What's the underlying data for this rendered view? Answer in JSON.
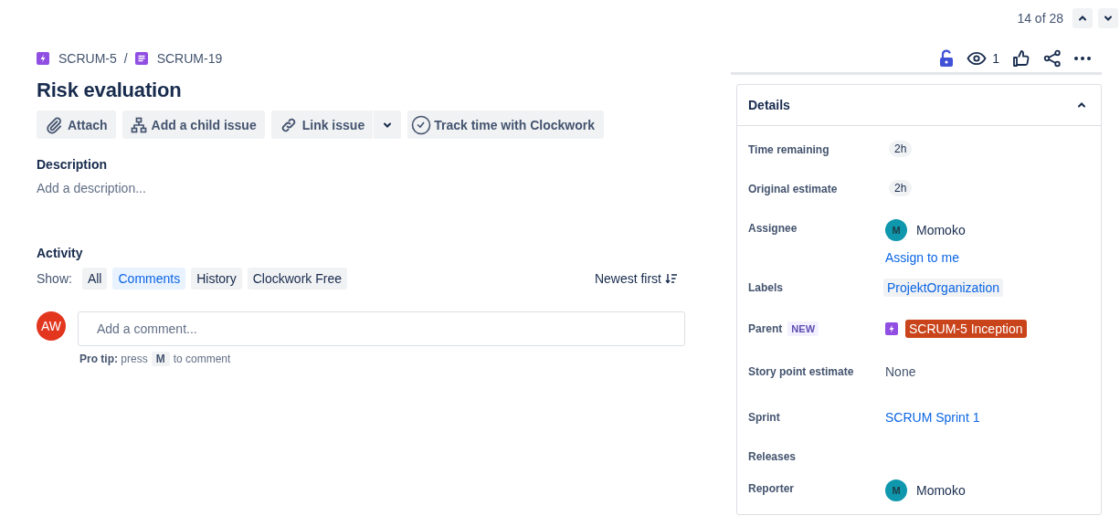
{
  "pager": {
    "text": "14 of 28"
  },
  "breadcrumbs": [
    {
      "kind": "epic",
      "label": "SCRUM-5"
    },
    {
      "kind": "story",
      "label": "SCRUM-19"
    }
  ],
  "breadcrumb_separator": "/",
  "title": "Risk evaluation",
  "actions": [
    {
      "kind": "attach",
      "label": "Attach",
      "menu": false
    },
    {
      "kind": "child",
      "label": "Add a child issue",
      "menu": false
    },
    {
      "kind": "link",
      "label": "Link issue",
      "menu": true
    },
    {
      "kind": "clock",
      "label": "Track time with Clockwork",
      "menu": false
    }
  ],
  "description": {
    "heading": "Description",
    "placeholder": "Add a description..."
  },
  "activity": {
    "heading": "Activity",
    "show_label": "Show:",
    "filters": [
      {
        "label": "All",
        "selected": false
      },
      {
        "label": "Comments",
        "selected": true
      },
      {
        "label": "History",
        "selected": false
      },
      {
        "label": "Clockwork Free",
        "selected": false
      }
    ],
    "sort": "Newest first",
    "avatar": "AW",
    "comment_placeholder": "Add a comment...",
    "tip": "**Pro tip:** press",
    "tip_key": "M",
    "tip_end": "to comment"
  },
  "toolbar": {
    "watchers": "1"
  },
  "details": {
    "title": "Details",
    "expanded": true,
    "fields": [
      {
        "kind": "chip",
        "label": "Time remaining",
        "value": "2h"
      },
      {
        "kind": "chip",
        "label": "Original estimate",
        "value": "2h"
      },
      {
        "kind": "user",
        "label": "Assignee",
        "initial": "M",
        "value": "Momoko",
        "action": "Assign to me"
      },
      {
        "kind": "tag",
        "label": "Labels",
        "value": "ProjektOrganization"
      },
      {
        "kind": "parent",
        "label": "Parent",
        "badge": "NEW",
        "value": "SCRUM-5 Inception"
      },
      {
        "kind": "text",
        "label": "Story point estimate",
        "value": "None"
      },
      {
        "kind": "link",
        "label": "Sprint",
        "value": "SCRUM Sprint 1"
      },
      {
        "kind": "empty",
        "label": "Releases"
      },
      {
        "kind": "user",
        "label": "Reporter",
        "initial": "M",
        "value": "Momoko"
      }
    ]
  }
}
